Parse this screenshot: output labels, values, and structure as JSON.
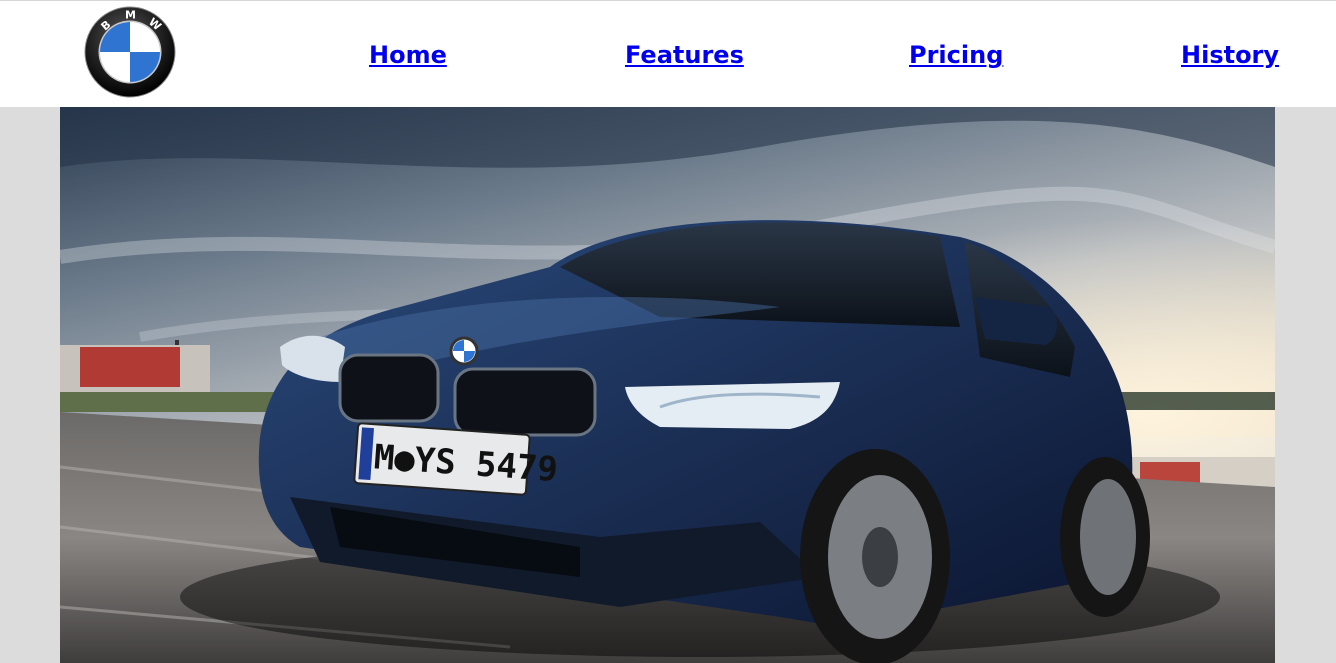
{
  "header": {
    "logo_letters": "BMW",
    "nav": [
      {
        "label": "Home"
      },
      {
        "label": "Features"
      },
      {
        "label": "Pricing"
      },
      {
        "label": "History"
      }
    ]
  },
  "hero": {
    "license_plate": "M●YS 5479",
    "car_color": "#1b2f55"
  },
  "colors": {
    "link": "#0000ee",
    "page_background": "#dcdcdc",
    "header_background": "#ffffff",
    "logo_blue": "#2f74d0"
  }
}
